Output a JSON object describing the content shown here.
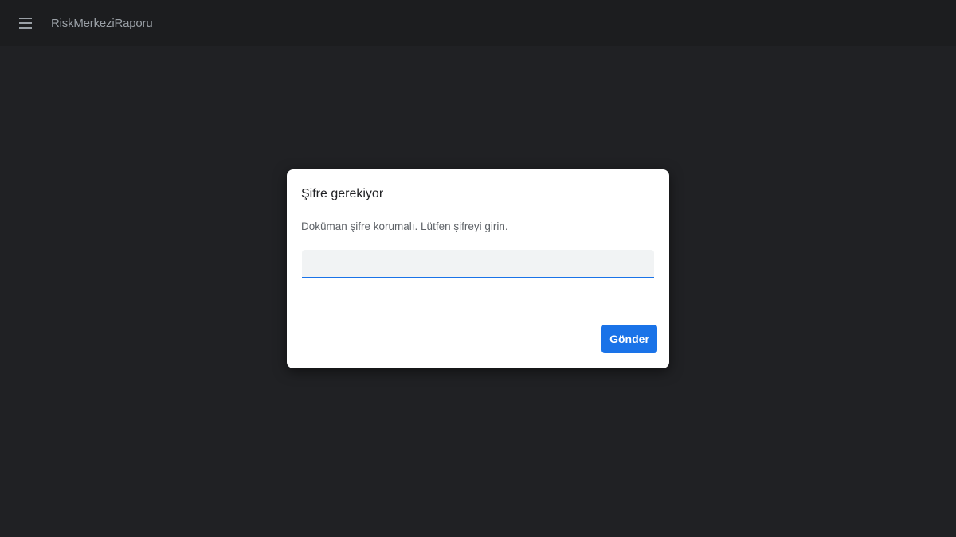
{
  "toolbar": {
    "menu_icon": "hamburger-menu-icon",
    "title": "RiskMerkeziRaporu"
  },
  "dialog": {
    "title": "Şifre gerekiyor",
    "message": "Doküman şifre korumalı. Lütfen şifreyi girin.",
    "password_value": "",
    "submit_label": "Gönder"
  },
  "colors": {
    "background": "#202124",
    "toolbar": "#1c1d1f",
    "accent": "#1a73e8",
    "dialog": "#ffffff"
  }
}
